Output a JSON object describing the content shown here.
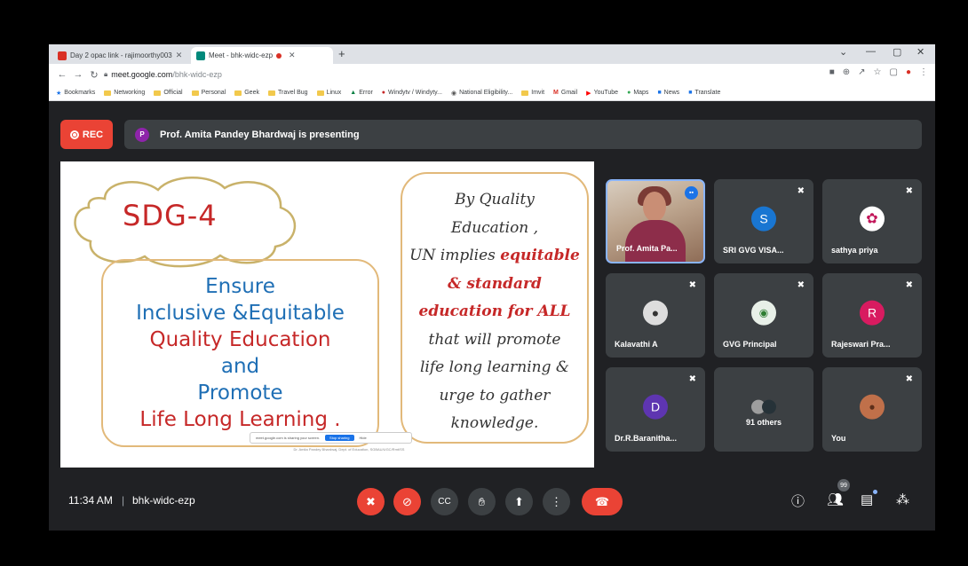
{
  "browser": {
    "tabs": [
      {
        "label": "Day 2 opac link - rajimoorthy003"
      },
      {
        "label": "Meet - bhk-widc-ezp"
      }
    ],
    "url": {
      "domain": "meet.google.com",
      "path": "/bhk-widc-ezp"
    },
    "bookmarks": [
      "Bookmarks",
      "Networking",
      "Official",
      "Personal",
      "Geek",
      "Travel Bug",
      "Linux",
      "Error",
      "Windytv / Windyty...",
      "National Eligibility...",
      "Imvit",
      "Gmail",
      "YouTube",
      "Maps",
      "News",
      "Translate"
    ]
  },
  "meet": {
    "rec_label": "REC",
    "presenter_initial": "P",
    "presenting_text": "Prof. Amita Pandey Bhardwaj is presenting",
    "time": "11:34 AM",
    "separator": "|",
    "meeting_code": "bhk-widc-ezp",
    "people_badge": "99"
  },
  "slide": {
    "title": "SDG-4",
    "left_lines": [
      {
        "text": "Ensure",
        "color": "blue"
      },
      {
        "text": "Inclusive &Equitable",
        "color": "blue"
      },
      {
        "text": "Quality Education",
        "color": "red"
      },
      {
        "text": "and",
        "color": "blue"
      },
      {
        "text": "Promote",
        "color": "blue"
      },
      {
        "text": "Life Long Learning .",
        "color": "red"
      }
    ],
    "right_lines": [
      {
        "text": "By Quality",
        "highlight": false
      },
      {
        "text": "Education ,",
        "highlight": false
      },
      {
        "text": "UN implies equitable",
        "highlight": "equitable"
      },
      {
        "text": "& standard",
        "highlight": true
      },
      {
        "text": "education for ALL",
        "highlight": true
      },
      {
        "text": "that will promote",
        "highlight": false
      },
      {
        "text": "life long learning &",
        "highlight": false
      },
      {
        "text": "urge to gather",
        "highlight": false
      },
      {
        "text": "knowledge.",
        "highlight": false
      }
    ],
    "share_notice": "meet.google.com is sharing your screen.",
    "stop_sharing": "Stop sharing",
    "hide": "Hide",
    "footer": "Dr. Amita Pandey Bhardwaj, Dept. of Education, SGBAU/UGC/Rmt/SS"
  },
  "participants": [
    {
      "name": "Prof. Amita Pa...",
      "type": "video"
    },
    {
      "name": "SRI GVG VISA...",
      "initial": "S",
      "avatar_color": "#1976d2"
    },
    {
      "name": "sathya priya",
      "initial": "",
      "avatar_color": "#ffffff"
    },
    {
      "name": "Kalavathi A",
      "initial": "",
      "avatar_color": "#dddddd"
    },
    {
      "name": "GVG Principal",
      "initial": "",
      "avatar_color": "#e8f0e8"
    },
    {
      "name": "Rajeswari Pra...",
      "initial": "R",
      "avatar_color": "#d81b60"
    },
    {
      "name": "Dr.R.Baranitha...",
      "initial": "D",
      "avatar_color": "#5e35b1"
    },
    {
      "name": "91 others",
      "initial": "",
      "avatar_color": "#9e9e9e"
    },
    {
      "name": "You",
      "initial": "",
      "avatar_color": "#c0704a"
    }
  ],
  "colors": {
    "blue": "#1f6fb5",
    "red": "#c62828",
    "meet_red": "#ea4335"
  }
}
